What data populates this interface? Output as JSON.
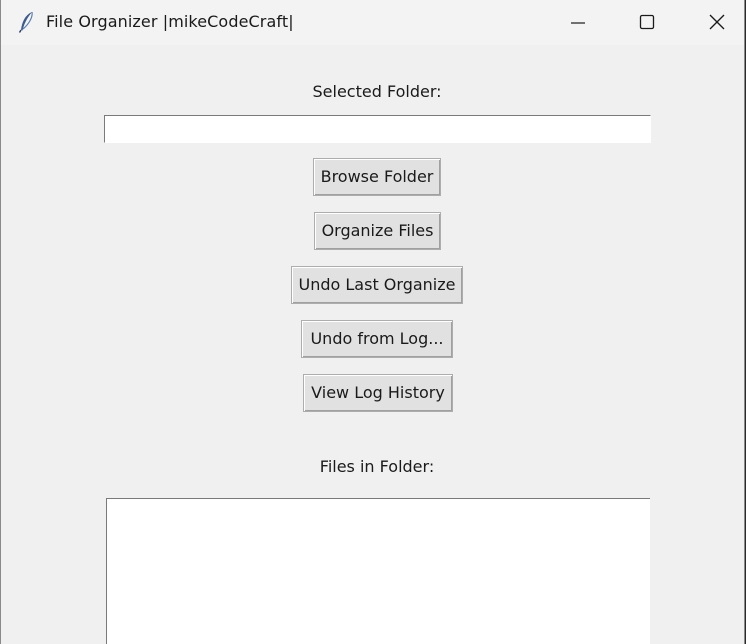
{
  "window": {
    "title": "File Organizer |mikeCodeCraft|",
    "app_icon": "feather-icon",
    "controls": {
      "minimize_icon": "minimize-icon",
      "maximize_icon": "maximize-icon",
      "close_icon": "close-icon"
    }
  },
  "main": {
    "selected_folder_label": "Selected Folder:",
    "selected_folder_value": "",
    "buttons": {
      "browse": "Browse Folder",
      "organize": "Organize Files",
      "undo_last": "Undo Last Organize",
      "undo_from_log": "Undo from Log...",
      "view_log": "View Log History"
    },
    "files_label": "Files in Folder:",
    "files": []
  },
  "colors": {
    "window_bg": "#f0f0f0",
    "button_bg": "#e1e1e1",
    "field_bg": "#ffffff"
  }
}
